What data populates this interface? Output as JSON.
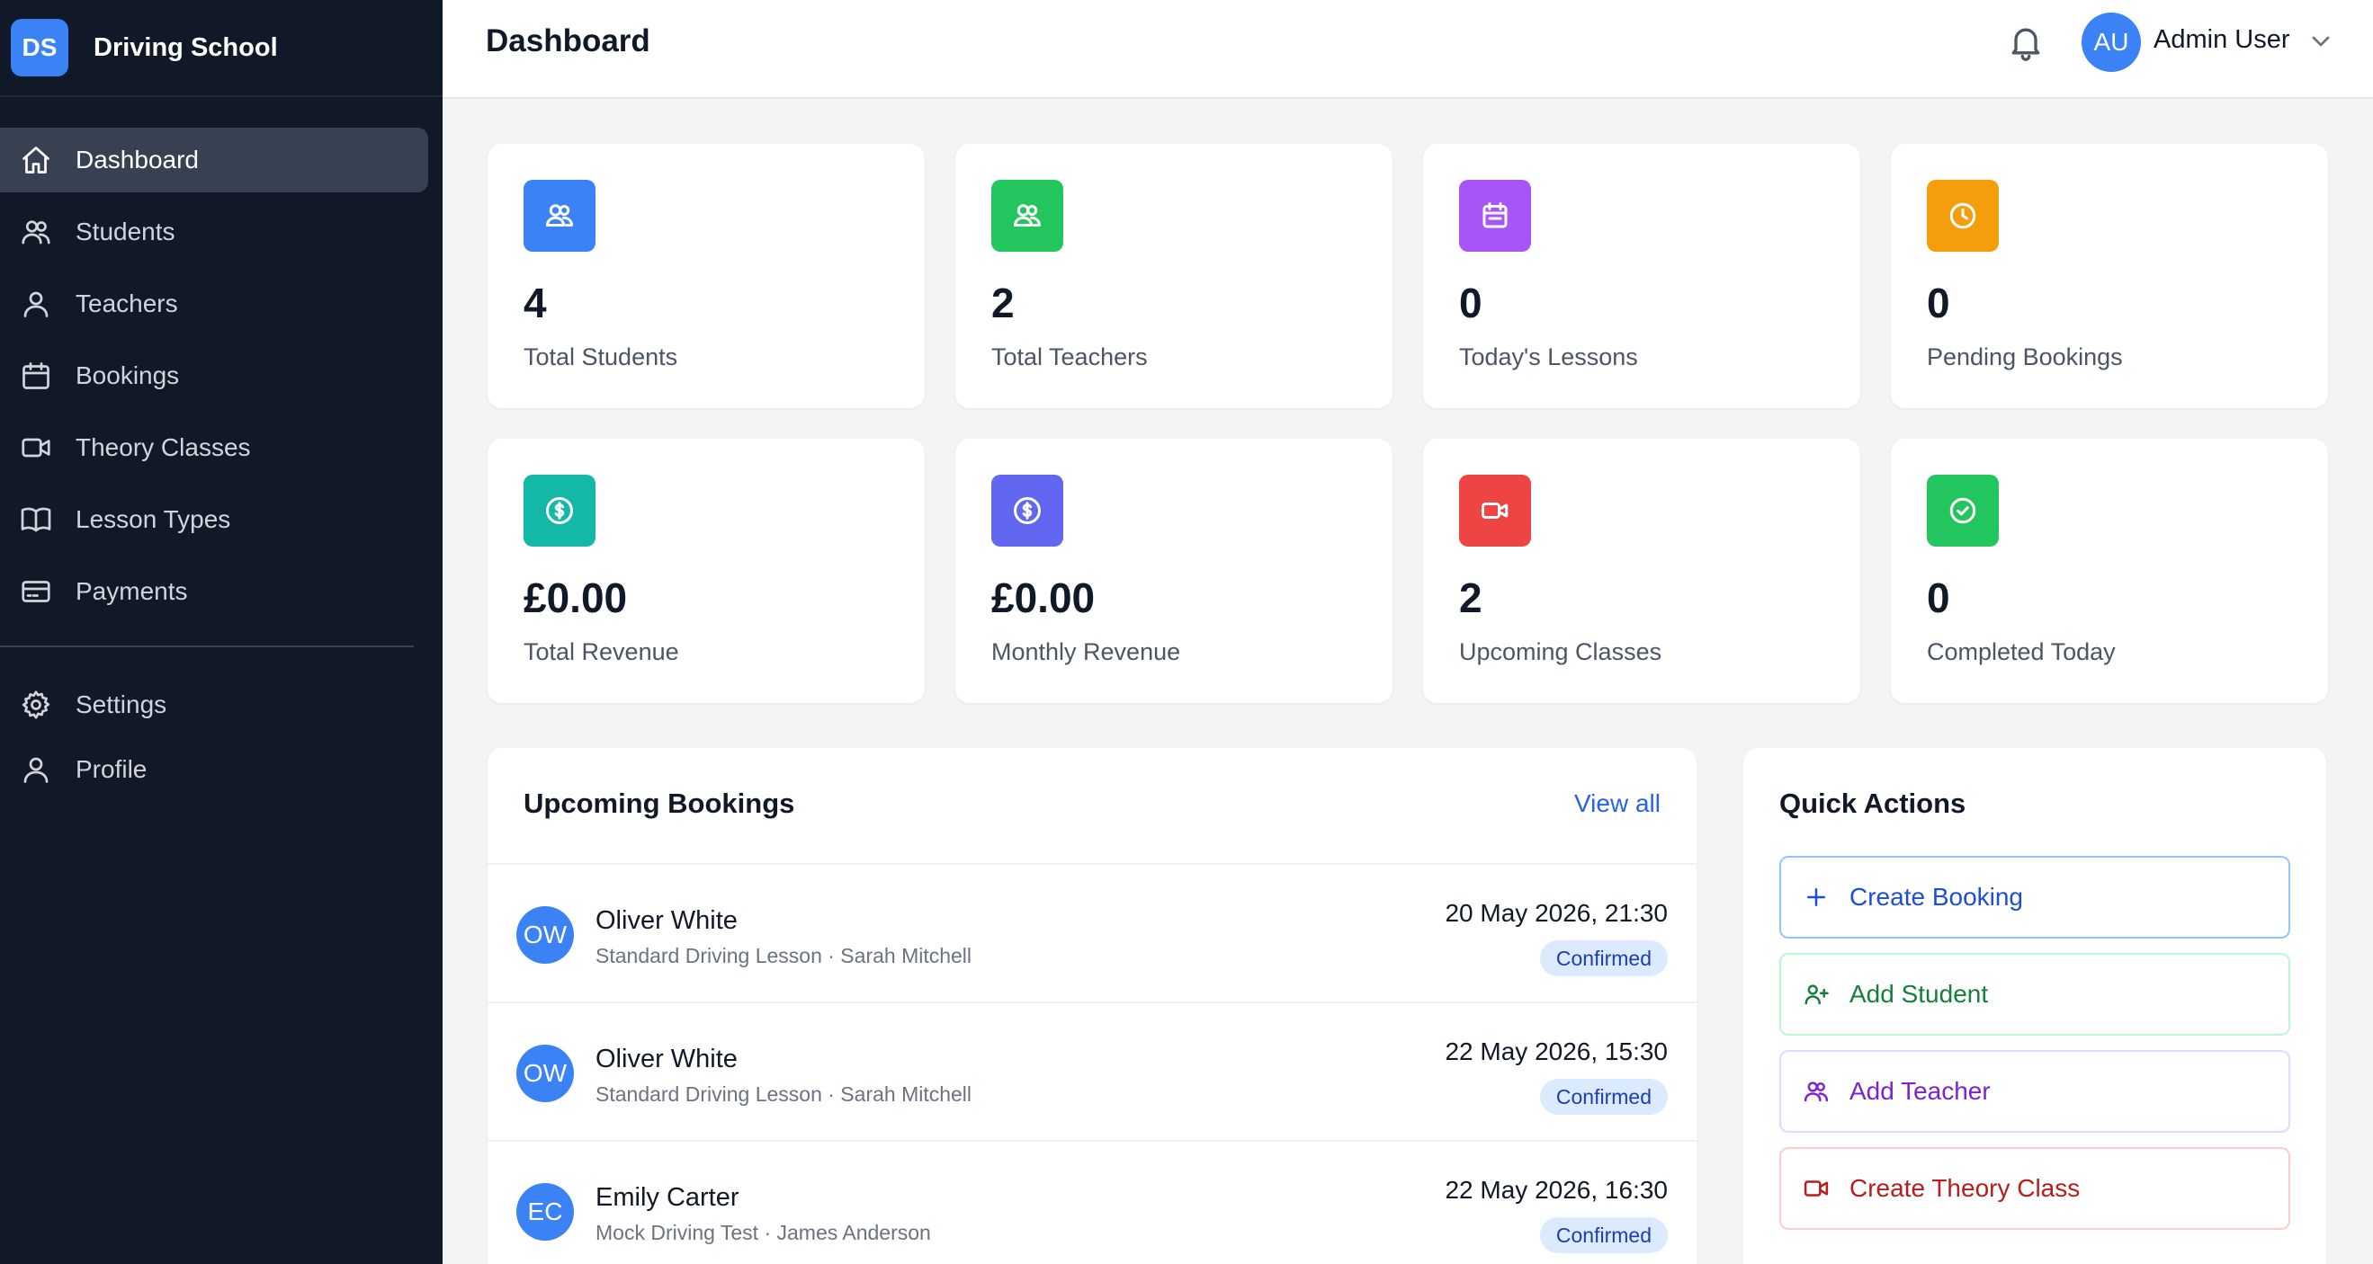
{
  "brand": {
    "initials": "DS",
    "name": "Driving School"
  },
  "nav": {
    "items": [
      {
        "label": "Dashboard",
        "icon": "home-icon",
        "active": true
      },
      {
        "label": "Students",
        "icon": "users-icon"
      },
      {
        "label": "Teachers",
        "icon": "user-icon"
      },
      {
        "label": "Bookings",
        "icon": "calendar-icon"
      },
      {
        "label": "Theory Classes",
        "icon": "video-icon"
      },
      {
        "label": "Lesson Types",
        "icon": "book-icon"
      },
      {
        "label": "Payments",
        "icon": "credit-card-icon"
      }
    ],
    "secondary": [
      {
        "label": "Settings",
        "icon": "gear-icon"
      },
      {
        "label": "Profile",
        "icon": "user-icon"
      }
    ]
  },
  "header": {
    "title": "Dashboard",
    "user": {
      "initials": "AU",
      "name": "Admin User"
    }
  },
  "stats": [
    {
      "value": "4",
      "label": "Total Students",
      "icon": "users-icon",
      "color": "#3b82f6"
    },
    {
      "value": "2",
      "label": "Total Teachers",
      "icon": "users-icon",
      "color": "#22c55e"
    },
    {
      "value": "0",
      "label": "Today's Lessons",
      "icon": "calendar-icon",
      "color": "#a855f7"
    },
    {
      "value": "0",
      "label": "Pending Bookings",
      "icon": "clock-icon",
      "color": "#f59e0b"
    },
    {
      "value": "£0.00",
      "label": "Total Revenue",
      "icon": "dollar-icon",
      "color": "#14b8a6"
    },
    {
      "value": "£0.00",
      "label": "Monthly Revenue",
      "icon": "dollar-icon",
      "color": "#6366f1"
    },
    {
      "value": "2",
      "label": "Upcoming Classes",
      "icon": "video-icon",
      "color": "#ef4444"
    },
    {
      "value": "0",
      "label": "Completed Today",
      "icon": "check-circle-icon",
      "color": "#22c55e"
    }
  ],
  "bookings": {
    "title": "Upcoming Bookings",
    "view_all": "View all",
    "items": [
      {
        "initials": "OW",
        "name": "Oliver White",
        "detail": "Standard Driving Lesson · Sarah Mitchell",
        "datetime": "20 May 2026, 21:30",
        "status": "Confirmed"
      },
      {
        "initials": "OW",
        "name": "Oliver White",
        "detail": "Standard Driving Lesson · Sarah Mitchell",
        "datetime": "22 May 2026, 15:30",
        "status": "Confirmed"
      },
      {
        "initials": "EC",
        "name": "Emily Carter",
        "detail": "Mock Driving Test · James Anderson",
        "datetime": "22 May 2026, 16:30",
        "status": "Confirmed"
      }
    ]
  },
  "quick_actions": {
    "title": "Quick Actions",
    "items": [
      {
        "label": "Create Booking",
        "icon": "plus-icon",
        "color": "#1d4ed8",
        "border": "#93c5fd"
      },
      {
        "label": "Add Student",
        "icon": "user-plus-icon",
        "color": "#15803d",
        "border": "#bbf7d0"
      },
      {
        "label": "Add Teacher",
        "icon": "users-icon",
        "color": "#7e22ce",
        "border": "#e9d5ff"
      },
      {
        "label": "Create Theory Class",
        "icon": "video-icon",
        "color": "#b91c1c",
        "border": "#fecaca"
      }
    ]
  }
}
